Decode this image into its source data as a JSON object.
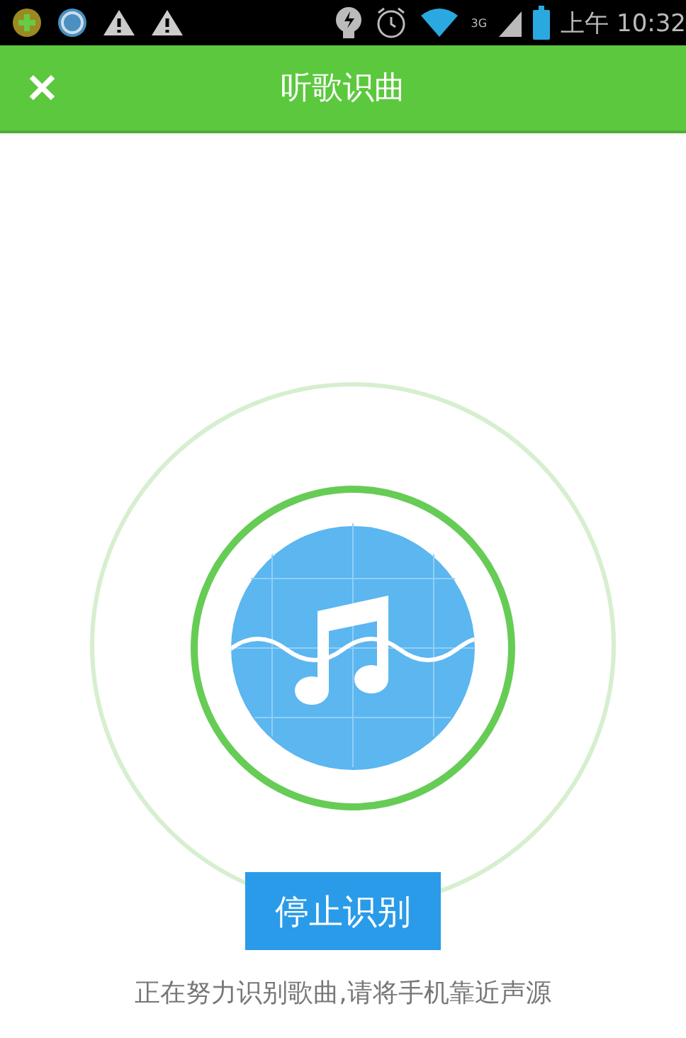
{
  "status_bar": {
    "time": "上午 10:32",
    "network": "3G"
  },
  "header": {
    "close": "✕",
    "title": "听歌识曲"
  },
  "recognizer": {
    "stop_button": "停止识别",
    "hint": "正在努力识别歌曲,请将手机靠近声源"
  }
}
